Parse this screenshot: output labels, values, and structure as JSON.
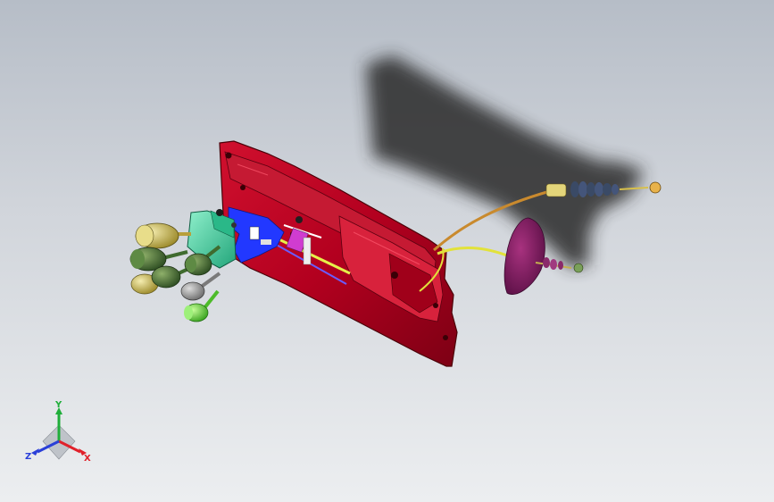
{
  "viewport": {
    "background_top": "#b6bdc7",
    "background_bottom": "#eceef0"
  },
  "model": {
    "bracket_color": "#b3001f",
    "housing_color": "#3fd6a6",
    "knob_colors": [
      "#d8c96a",
      "#4f7a3b",
      "#9a9a9a",
      "#6fd23a"
    ],
    "cable_colors": [
      "#c98a2e",
      "#e2e23a"
    ],
    "boot_color": "#7a1a5e",
    "bellows_color": "#3a4a66"
  },
  "triad": {
    "x_label": "X",
    "y_label": "Y",
    "z_label": "Z",
    "x_color": "#e0202a",
    "y_color": "#1fae3a",
    "z_color": "#2a3fd8"
  }
}
